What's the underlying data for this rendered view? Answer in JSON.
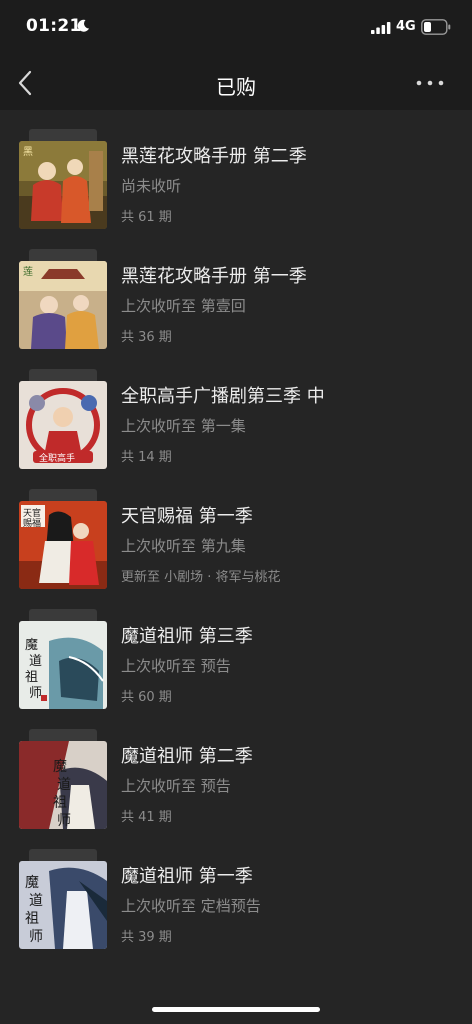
{
  "status_bar": {
    "time": "01:21",
    "network": "4G",
    "icons": [
      "moon-icon",
      "signal-icon",
      "battery-icon"
    ]
  },
  "nav": {
    "title": "已购",
    "back_icon": "chevron-left-icon",
    "more_icon": "more-dots-icon"
  },
  "items": [
    {
      "title": "黑莲花攻略手册 第二季",
      "progress": "尚未收听",
      "count": "共 61 期",
      "cover_accent": "#c85a3a"
    },
    {
      "title": "黑莲花攻略手册 第一季",
      "progress": "上次收听至 第壹回",
      "count": "共 36 期",
      "cover_accent": "#d8a24a"
    },
    {
      "title": "全职高手广播剧第三季 中",
      "progress": "上次收听至 第一集",
      "count": "共 14 期",
      "cover_accent": "#c02a2a"
    },
    {
      "title": "天官赐福 第一季",
      "progress": "上次收听至 第九集",
      "count": "更新至 小剧场 · 将军与桃花",
      "cover_accent": "#c8401e"
    },
    {
      "title": "魔道祖师 第三季",
      "progress": "上次收听至 预告",
      "count": "共 60 期",
      "cover_accent": "#5a8a98"
    },
    {
      "title": "魔道祖师 第二季",
      "progress": "上次收听至 预告",
      "count": "共 41 期",
      "cover_accent": "#8a2a2a"
    },
    {
      "title": "魔道祖师 第一季",
      "progress": "上次收听至 定档预告",
      "count": "共 39 期",
      "cover_accent": "#3a4a6a"
    }
  ]
}
